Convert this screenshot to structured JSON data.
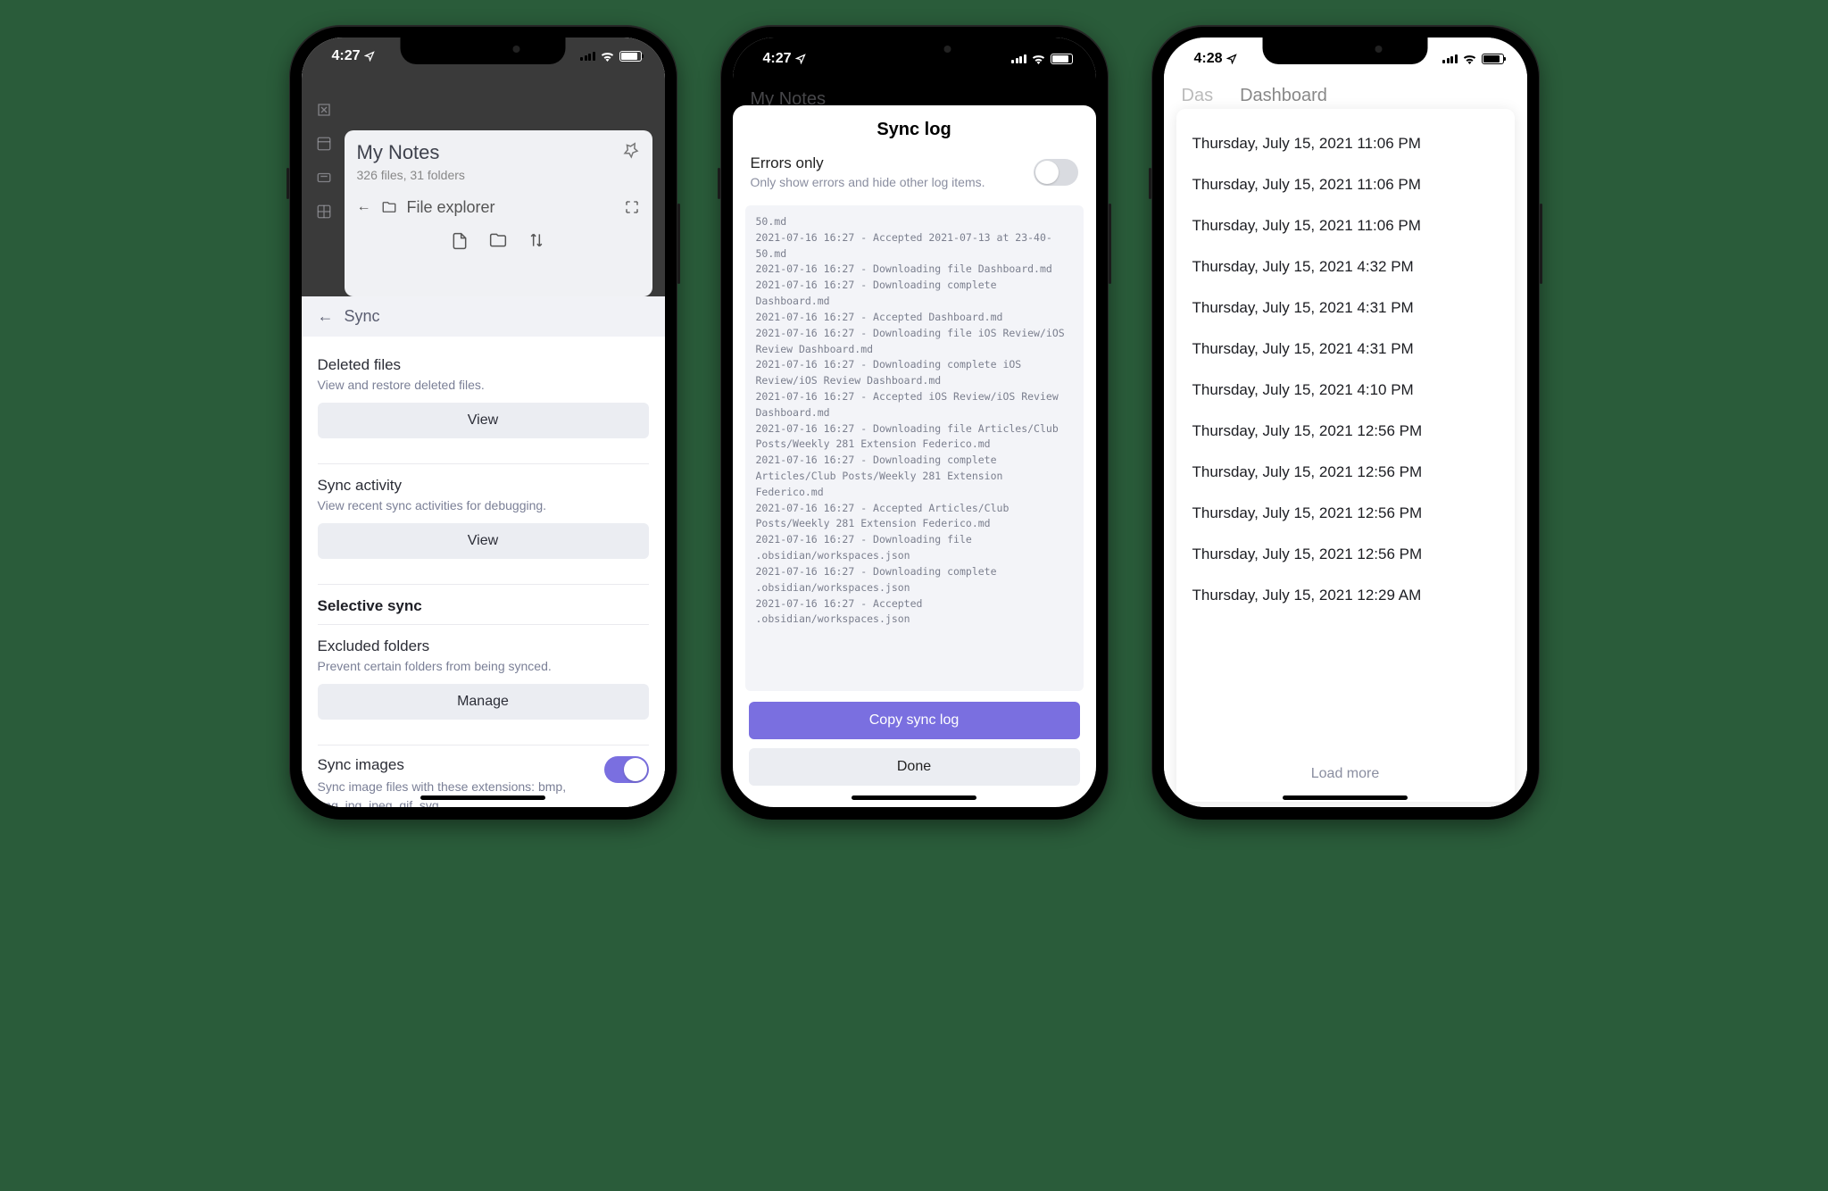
{
  "statusbar": {
    "time1": "4:27",
    "time2": "4:27",
    "time3": "4:28"
  },
  "phone1": {
    "vault_title": "My Notes",
    "vault_counts": "326 files, 31 folders",
    "file_explorer_label": "File explorer",
    "sheet_back_label": "Sync",
    "deleted": {
      "title": "Deleted files",
      "desc": "View and restore deleted files.",
      "btn": "View"
    },
    "activity": {
      "title": "Sync activity",
      "desc": "View recent sync activities for debugging.",
      "btn": "View"
    },
    "section_selective": "Selective sync",
    "excluded": {
      "title": "Excluded folders",
      "desc": "Prevent certain folders from being synced.",
      "btn": "Manage"
    },
    "images": {
      "title": "Sync images",
      "desc": "Sync image files with these extensions: bmp, png, jpg, jpeg, gif, svg."
    }
  },
  "phone2": {
    "title": "Sync log",
    "errors_only_title": "Errors only",
    "errors_only_desc": "Only show errors and hide other log items.",
    "log_lines": [
      "50.md",
      "2021-07-16 16:27 - Accepted 2021-07-13 at 23-40-50.md",
      "2021-07-16 16:27 - Downloading file Dashboard.md",
      "2021-07-16 16:27 - Downloading complete Dashboard.md",
      "2021-07-16 16:27 - Accepted Dashboard.md",
      "2021-07-16 16:27 - Downloading file iOS Review/iOS Review Dashboard.md",
      "2021-07-16 16:27 - Downloading complete iOS Review/iOS Review Dashboard.md",
      "2021-07-16 16:27 - Accepted iOS Review/iOS Review Dashboard.md",
      "2021-07-16 16:27 - Downloading file Articles/Club Posts/Weekly 281 Extension Federico.md",
      "2021-07-16 16:27 - Downloading complete Articles/Club Posts/Weekly 281 Extension Federico.md",
      "2021-07-16 16:27 - Accepted Articles/Club Posts/Weekly 281 Extension Federico.md",
      "2021-07-16 16:27 - Downloading file .obsidian/workspaces.json",
      "2021-07-16 16:27 - Downloading complete .obsidian/workspaces.json",
      "2021-07-16 16:27 - Accepted .obsidian/workspaces.json"
    ],
    "copy_btn": "Copy sync log",
    "done_btn": "Done",
    "behind_vault": "My Notes"
  },
  "phone3": {
    "header_left": "Das",
    "header_title": "Dashboard",
    "timestamps": [
      "Thursday, July 15, 2021 11:06 PM",
      "Thursday, July 15, 2021 11:06 PM",
      "Thursday, July 15, 2021 11:06 PM",
      "Thursday, July 15, 2021 4:32 PM",
      "Thursday, July 15, 2021 4:31 PM",
      "Thursday, July 15, 2021 4:31 PM",
      "Thursday, July 15, 2021 4:10 PM",
      "Thursday, July 15, 2021 12:56 PM",
      "Thursday, July 15, 2021 12:56 PM",
      "Thursday, July 15, 2021 12:56 PM",
      "Thursday, July 15, 2021 12:56 PM",
      "Thursday, July 15, 2021 12:29 AM"
    ],
    "load_more": "Load more"
  }
}
